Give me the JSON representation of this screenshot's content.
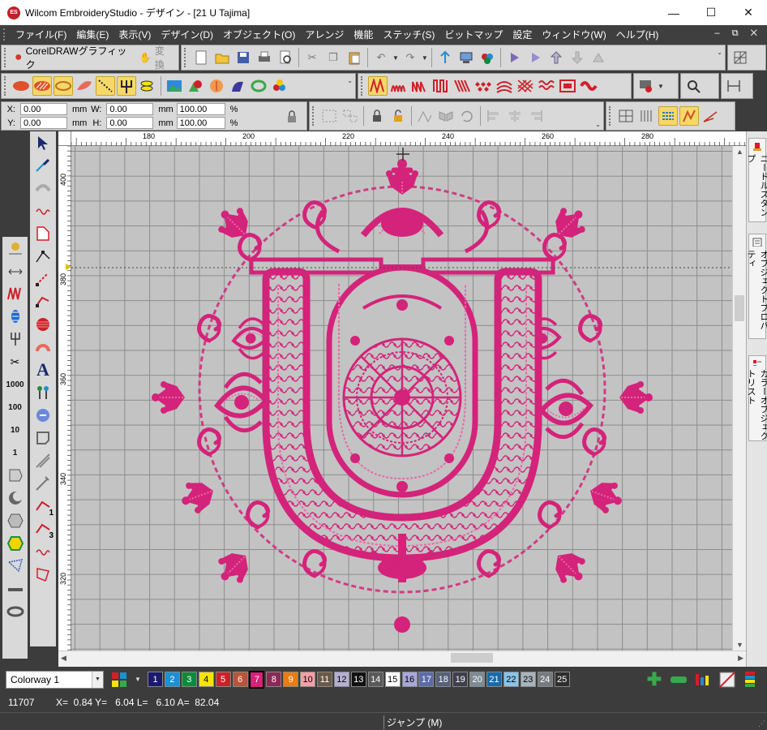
{
  "window": {
    "app_icon": "ES",
    "title": "Wilcom EmbroideryStudio - デザイン - [21  U          Tajima]",
    "minimize": "—",
    "maximize": "☐",
    "close": "✕"
  },
  "menu": {
    "items": [
      "ファイル(F)",
      "編集(E)",
      "表示(V)",
      "デザイン(D)",
      "オブジェクト(O)",
      "アレンジ",
      "機能",
      "ステッチ(S)",
      "ビットマップ",
      "設定",
      "ウィンドウ(W)",
      "ヘルプ(H)"
    ],
    "mdi_buttons": "–  ⧉  ✕"
  },
  "toolbar": {
    "coreldraw_label": "CorelDRAWグラフィック",
    "convert_label": "変換"
  },
  "property_bar": {
    "x_label": "X:",
    "x_value": "0.00",
    "y_label": "Y:",
    "y_value": "0.00",
    "w_label": "W:",
    "w_value": "0.00",
    "h_label": "H:",
    "h_value": "0.00",
    "unit_mm": "mm",
    "scale_w": "100.00",
    "scale_h": "100.00",
    "percent": "%"
  },
  "rulers": {
    "horizontal": [
      "180",
      "200",
      "220",
      "240",
      "260",
      "280"
    ],
    "vertical": [
      "400",
      "380",
      "360",
      "340",
      "320"
    ]
  },
  "left_tool_numbers": [
    "1000",
    "100",
    "10",
    "1"
  ],
  "left_tool_counts": [
    "1",
    "3"
  ],
  "dockers": {
    "tab1": "ニードルスタンプ",
    "tab2": "オブジェクトプロパティ",
    "tab3": "カラーオブジェクトリスト"
  },
  "palette": {
    "colorway": "Colorway 1",
    "swatches": [
      {
        "n": "1",
        "c": "#1a1a6e"
      },
      {
        "n": "2",
        "c": "#1e8fd0"
      },
      {
        "n": "3",
        "c": "#0f8a3c"
      },
      {
        "n": "4",
        "c": "#f4e400"
      },
      {
        "n": "5",
        "c": "#d11f2a"
      },
      {
        "n": "6",
        "c": "#b5563a"
      },
      {
        "n": "7",
        "c": "#d4237a"
      },
      {
        "n": "8",
        "c": "#8a2a55"
      },
      {
        "n": "9",
        "c": "#e47d1a"
      },
      {
        "n": "10",
        "c": "#f4a0a6"
      },
      {
        "n": "11",
        "c": "#6a5a48"
      },
      {
        "n": "12",
        "c": "#b6afd3"
      },
      {
        "n": "13",
        "c": "#111111"
      },
      {
        "n": "14",
        "c": "#5a5a5a"
      },
      {
        "n": "15",
        "c": "#ffffff"
      },
      {
        "n": "16",
        "c": "#a7a7d8"
      },
      {
        "n": "17",
        "c": "#5b6da8"
      },
      {
        "n": "18",
        "c": "#56607a"
      },
      {
        "n": "19",
        "c": "#3e3e4e"
      },
      {
        "n": "20",
        "c": "#7e8a94"
      },
      {
        "n": "21",
        "c": "#1a6aa8"
      },
      {
        "n": "22",
        "c": "#8ac4ea"
      },
      {
        "n": "23",
        "c": "#a8b4bc"
      },
      {
        "n": "24",
        "c": "#777b80"
      },
      {
        "n": "25",
        "c": "#2e2e2e"
      }
    ]
  },
  "status": {
    "stitch_count": "11707",
    "coords": "X=  0.84 Y=   6.04 L=   6.10 A=  82.04",
    "mode": "ジャンプ (M)"
  },
  "colors": {
    "design_thread": "#d4237a",
    "canvas_bg": "#c3c3c3",
    "chrome_dark": "#3c3c3c"
  }
}
